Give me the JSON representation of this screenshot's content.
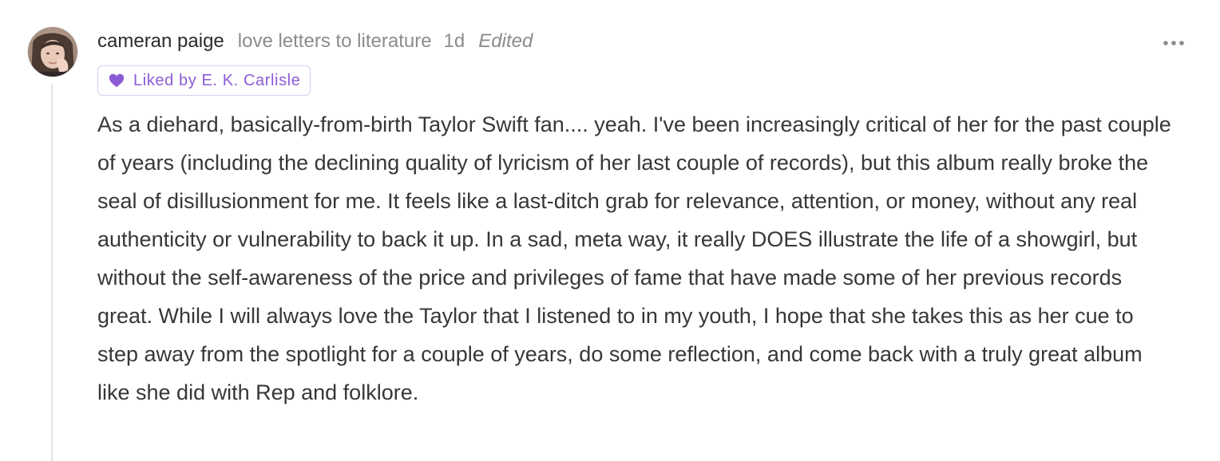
{
  "comment": {
    "author": "cameran paige",
    "publication": "love letters to literature",
    "age": "1d",
    "edited_label": "Edited",
    "liked_by": "Liked by E. K. Carlisle",
    "body": "As a diehard, basically-from-birth Taylor Swift fan.... yeah. I've been increasingly critical of her for the past couple of years (including the declining quality of lyricism of her last couple of records), but this album really broke the seal of disillusionment for me. It feels like a last-ditch grab for relevance, attention, or money, without any real authenticity or vulnerability to back it up. In a sad, meta way, it really DOES illustrate the life of a showgirl, but without the self-awareness of the price and privileges of fame that have made some of her previous records great. While I will always love the Taylor that I listened to in my youth, I hope that she takes this as her cue to step away from the spotlight for a couple of years, do some reflection, and come back with a truly great album like she did with Rep and folklore."
  },
  "icons": {
    "avatar": "user-avatar",
    "heart": "heart-icon",
    "more": "more-horizontal-icon"
  },
  "colors": {
    "accent": "#8c5cd6",
    "badge_border": "#d9cff0",
    "muted_text": "#8c8c8c",
    "body_text": "#363737",
    "thread_line": "#e4e4e4"
  }
}
